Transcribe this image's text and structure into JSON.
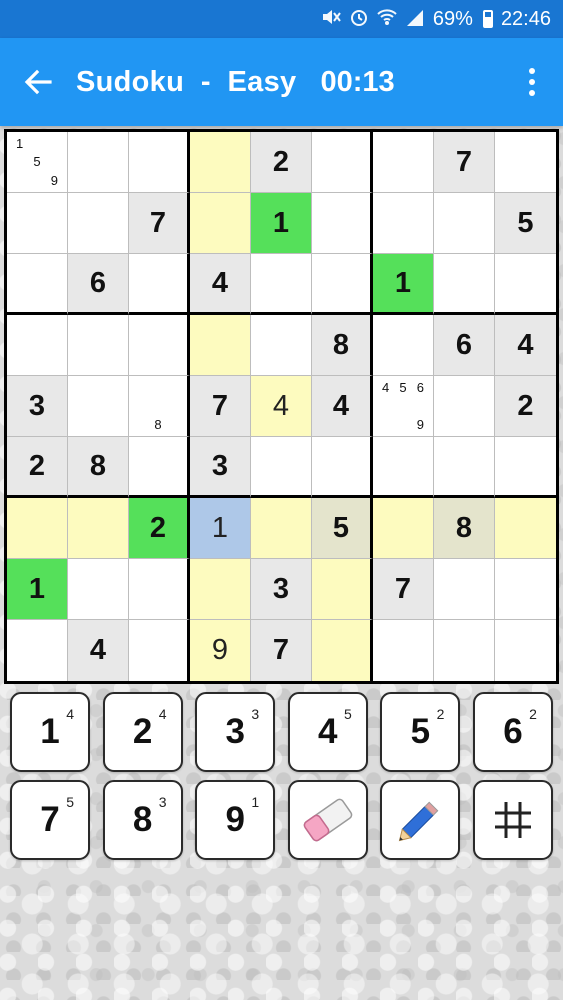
{
  "status_bar": {
    "battery_percent": "69%",
    "time": "22:46",
    "icons": [
      "mute-icon",
      "alarm-icon",
      "wifi-icon",
      "signal-icon",
      "battery-icon"
    ]
  },
  "app_bar": {
    "title": "Sudoku  -  Easy",
    "timer": "00:13"
  },
  "colors": {
    "status_bar": "#1976d2",
    "app_bar": "#2196f3",
    "given_cell": "#e8e8e8",
    "highlight": "#fdfbbf",
    "green_cell": "#55e05a",
    "selected_cell": "#aec8e8"
  },
  "board": {
    "cells": [
      [
        "",
        "",
        "",
        "",
        "2",
        "",
        "",
        "7",
        ""
      ],
      [
        "",
        "",
        "7",
        "",
        "1",
        "",
        "",
        "",
        "5"
      ],
      [
        "",
        "6",
        "",
        "4",
        "",
        "",
        "1",
        "",
        ""
      ],
      [
        "",
        "",
        "",
        "",
        "",
        "8",
        "",
        "6",
        "4"
      ],
      [
        "3",
        "",
        "",
        "7",
        "4",
        "4",
        "",
        "",
        "2"
      ],
      [
        "2",
        "8",
        "",
        "3",
        "",
        "",
        "",
        "",
        ""
      ],
      [
        "",
        "",
        "2",
        "1",
        "",
        "5",
        "",
        "8",
        ""
      ],
      [
        "1",
        "",
        "",
        "",
        "3",
        "",
        "7",
        "",
        ""
      ],
      [
        "",
        "4",
        "",
        "9",
        "7",
        "",
        "",
        "",
        ""
      ]
    ],
    "notes": {
      "0-0": [
        "1",
        "",
        "",
        "",
        "5",
        "",
        "",
        "",
        "9"
      ],
      "4-2": [
        "",
        "",
        "",
        "",
        "",
        "",
        "",
        "8",
        ""
      ],
      "4-6": [
        "4",
        "5",
        "6",
        "",
        "",
        "",
        "",
        "",
        "9"
      ]
    }
  },
  "keypad": {
    "digits": [
      {
        "digit": "1",
        "count": "4"
      },
      {
        "digit": "2",
        "count": "4"
      },
      {
        "digit": "3",
        "count": "3"
      },
      {
        "digit": "4",
        "count": "5"
      },
      {
        "digit": "5",
        "count": "2"
      },
      {
        "digit": "6",
        "count": "2"
      },
      {
        "digit": "7",
        "count": "5"
      },
      {
        "digit": "8",
        "count": "3"
      },
      {
        "digit": "9",
        "count": "1"
      }
    ],
    "tools": [
      "eraser-icon",
      "pencil-icon",
      "grid-icon"
    ]
  }
}
